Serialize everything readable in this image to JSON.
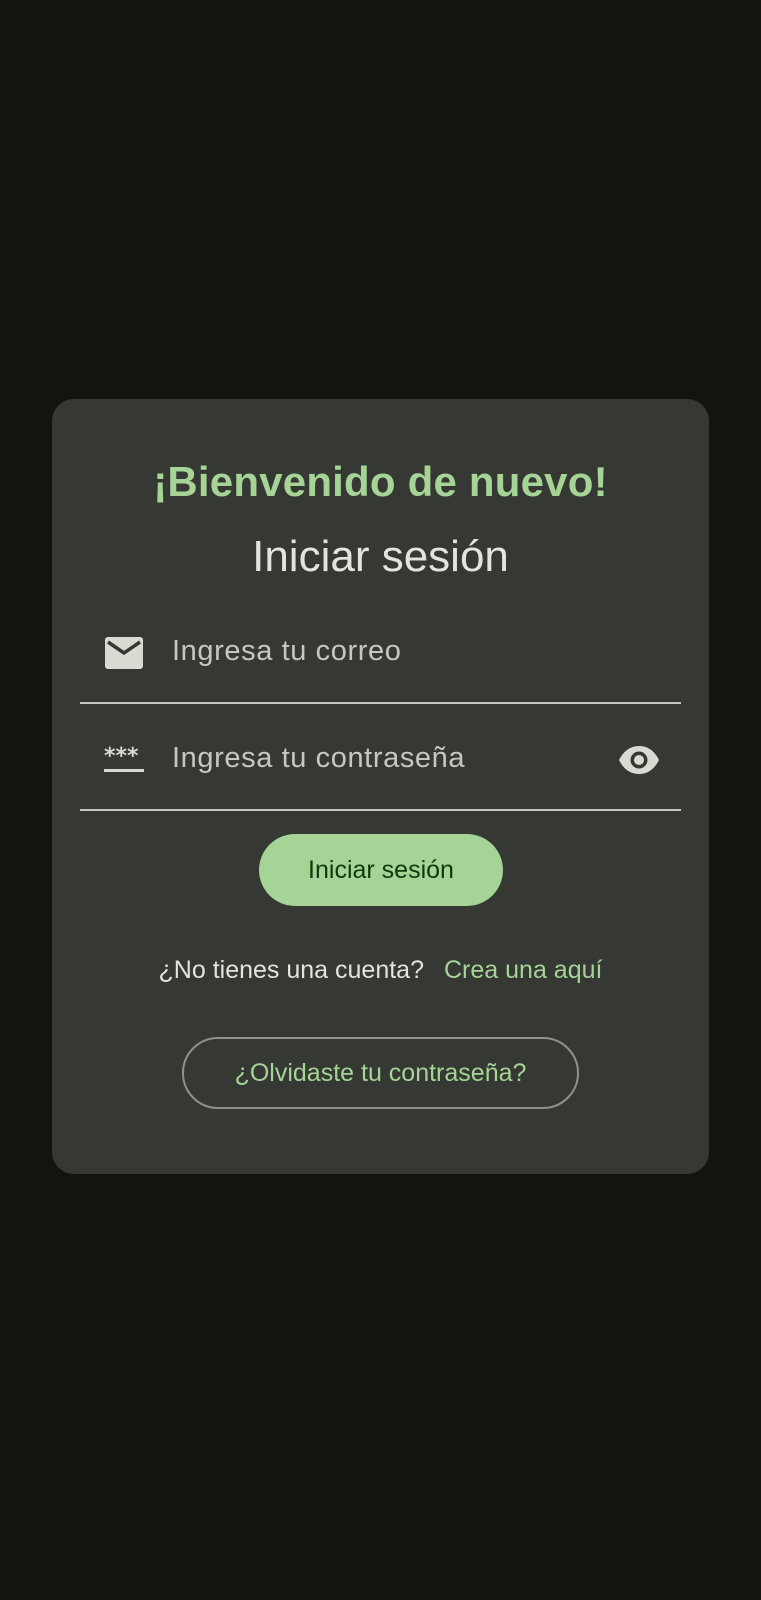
{
  "login_card": {
    "welcome_title": "¡Bienvenido de nuevo!",
    "subtitle": "Iniciar sesión",
    "email_field": {
      "placeholder": "Ingresa tu correo",
      "value": "",
      "icon": "mail-icon"
    },
    "password_field": {
      "placeholder": "Ingresa tu contraseña",
      "value": "",
      "icon": "password-icon",
      "toggle_icon": "eye-icon"
    },
    "login_button_label": "Iniciar sesión",
    "signup_prompt": "¿No tienes una cuenta?",
    "signup_link": "Crea una aquí",
    "forgot_password_button_label": "¿Olvidaste tu contraseña?"
  },
  "colors": {
    "background": "#121410",
    "card": "#353833",
    "accent": "#a5d496",
    "on_accent": "#10380a",
    "text": "#e3e4dc",
    "muted_text": "#c6c8bf",
    "outline": "#8f9289"
  }
}
